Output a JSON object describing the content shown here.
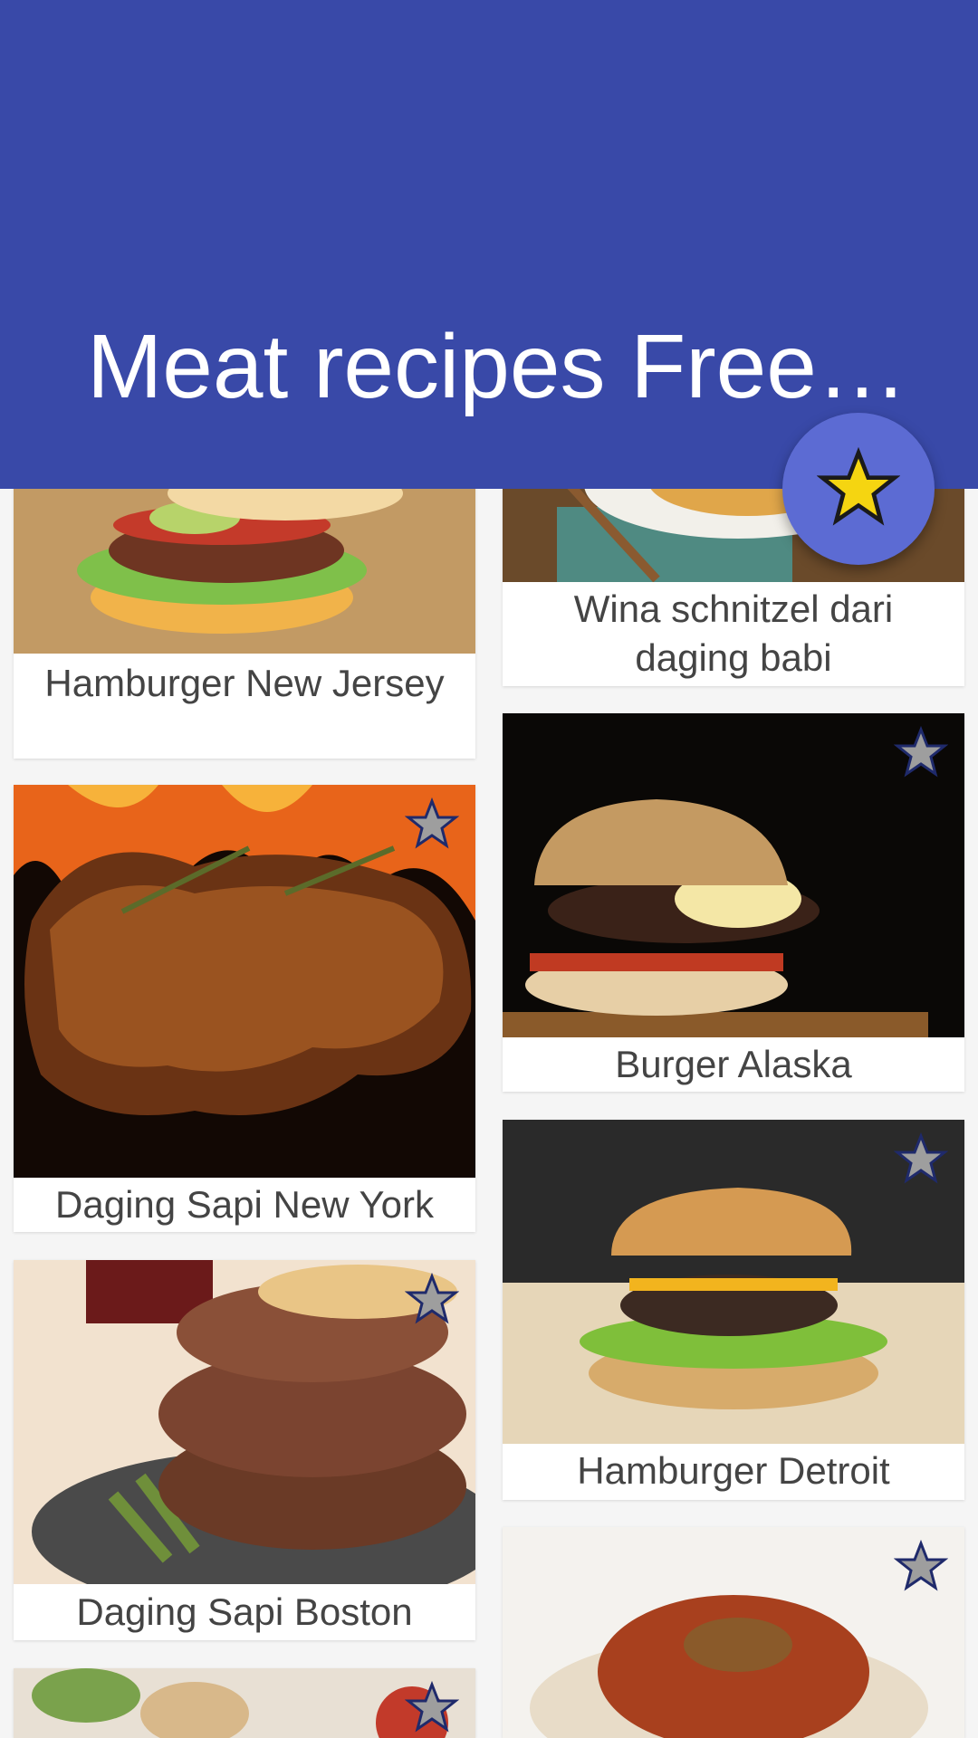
{
  "app_bar": {
    "title": "Meat recipes Free…",
    "color": "#3949a8"
  },
  "fab": {
    "icon": "star-icon",
    "color": "#5c6bd3",
    "star_color": "#f5d511"
  },
  "recipes": [
    {
      "title": "Hamburger New Jersey",
      "image": "hamburger-photo",
      "favorite": false
    },
    {
      "title": "Wina schnitzel dari daging babi",
      "image": "schnitzel-photo",
      "favorite": false
    },
    {
      "title": "Daging Sapi New York",
      "image": "grilled-meat-photo",
      "favorite": false
    },
    {
      "title": "Burger Alaska",
      "image": "burger-photo",
      "favorite": false
    },
    {
      "title": "Daging Sapi Boston",
      "image": "steak-photo",
      "favorite": false
    },
    {
      "title": "Hamburger Detroit",
      "image": "burger-photo",
      "favorite": false
    }
  ],
  "favorite_star_color": "#9e9e9e"
}
